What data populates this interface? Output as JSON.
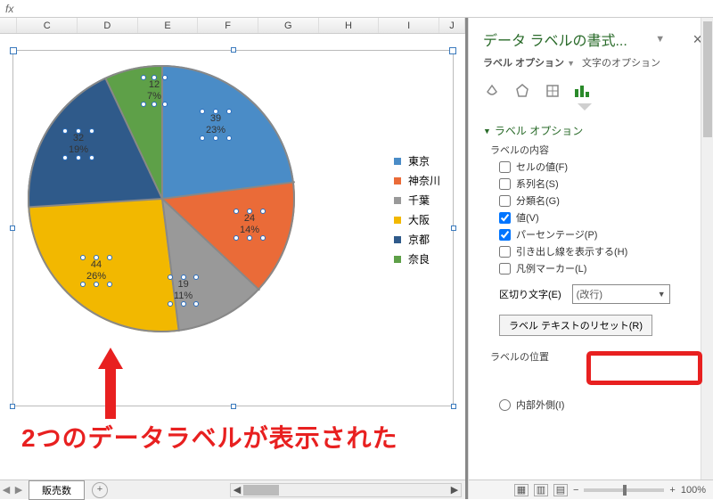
{
  "formula_bar": {
    "fx": "fx"
  },
  "columns": [
    "C",
    "D",
    "E",
    "F",
    "G",
    "H",
    "I",
    "J"
  ],
  "legend": [
    {
      "label": "東京",
      "color": "#4a8cc7"
    },
    {
      "label": "神奈川",
      "color": "#ea6b38"
    },
    {
      "label": "千葉",
      "color": "#999999"
    },
    {
      "label": "大阪",
      "color": "#f2b800"
    },
    {
      "label": "京都",
      "color": "#2f5a8a"
    },
    {
      "label": "奈良",
      "color": "#5ea048"
    }
  ],
  "labels": [
    {
      "v": "39",
      "p": "23%"
    },
    {
      "v": "24",
      "p": "14%"
    },
    {
      "v": "19",
      "p": "11%"
    },
    {
      "v": "44",
      "p": "26%"
    },
    {
      "v": "32",
      "p": "19%"
    },
    {
      "v": "12",
      "p": "7%"
    }
  ],
  "caption": "2つのデータラベルが表示された",
  "sheet_tab": "販売数",
  "panel": {
    "title": "データ ラベルの書式...",
    "subtabs": {
      "label_options": "ラベル オプション",
      "text_options": "文字のオプション"
    },
    "section_label_options": "ラベル オプション",
    "sub_label_content": "ラベルの内容",
    "checks": {
      "cell_value": "セルの値(F)",
      "series_name": "系列名(S)",
      "category_name": "分類名(G)",
      "value": "値(V)",
      "percentage": "パーセンテージ(P)",
      "leader_lines": "引き出し線を表示する(H)",
      "legend_marker": "凡例マーカー(L)"
    },
    "separator_label": "区切り文字(E)",
    "separator_value": "(改行)",
    "reset_button": "ラベル テキストのリセット(R)",
    "section_label_position": "ラベルの位置",
    "pos_inside_end": "内部外側(I)"
  },
  "status": {
    "zoom": "100%",
    "minus": "−",
    "plus": "+"
  },
  "chart_data": {
    "type": "pie",
    "title": "",
    "categories": [
      "東京",
      "神奈川",
      "千葉",
      "大阪",
      "京都",
      "奈良"
    ],
    "values": [
      39,
      24,
      19,
      44,
      32,
      12
    ],
    "percentages": [
      23,
      14,
      11,
      26,
      19,
      7
    ],
    "colors": [
      "#4a8cc7",
      "#ea6b38",
      "#999999",
      "#f2b800",
      "#2f5a8a",
      "#5ea048"
    ],
    "data_label_format": [
      "value",
      "percentage"
    ],
    "data_label_separator": "newline",
    "legend_position": "right"
  }
}
